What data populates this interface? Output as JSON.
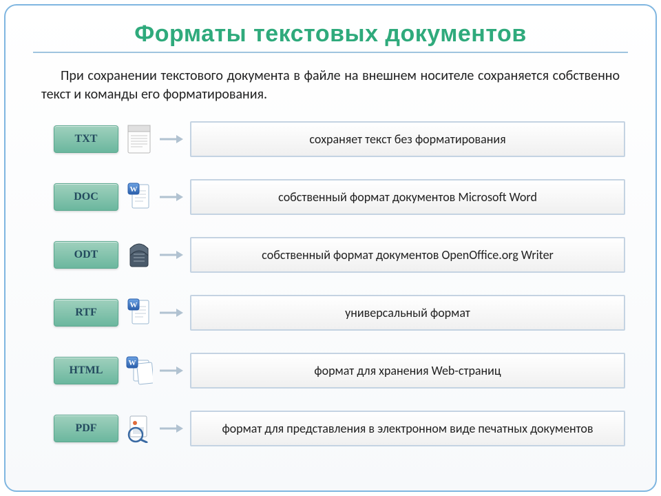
{
  "title": "Форматы текстовых документов",
  "intro": "При сохранении текстового документа в файле на внешнем носителе сохраняется собственно текст и команды его форматирования.",
  "formats": [
    {
      "code": "TXT",
      "icon": "txt",
      "desc": "сохраняет текст без форматирования"
    },
    {
      "code": "DOC",
      "icon": "doc",
      "desc": "собственный формат документов Microsoft Word"
    },
    {
      "code": "ODT",
      "icon": "odt",
      "desc": "собственный формат документов OpenOffice.org Writer"
    },
    {
      "code": "RTF",
      "icon": "rtf",
      "desc": "универсальный формат"
    },
    {
      "code": "HTML",
      "icon": "html",
      "desc": "формат для хранения Web-страниц"
    },
    {
      "code": "PDF",
      "icon": "pdf",
      "desc": "формат для представления в электронном виде печатных документов"
    }
  ]
}
